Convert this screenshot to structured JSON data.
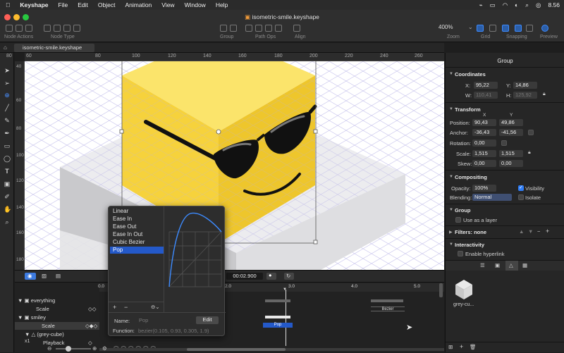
{
  "menubar": {
    "app": "Keyshape",
    "items": [
      "File",
      "Edit",
      "Object",
      "Animation",
      "View",
      "Window",
      "Help"
    ],
    "clock": "8.56"
  },
  "window": {
    "title": "isometric-smile.keyshape"
  },
  "toolbar": {
    "groups": [
      "Node Actions",
      "Node Type",
      "Group",
      "Path Ops",
      "Align",
      "Zoom",
      "Grid",
      "Snapping",
      "Preview"
    ],
    "zoom_value": "400%"
  },
  "tabs": {
    "document": "isometric-smile.keyshape"
  },
  "ruler": {
    "h_ticks": [
      "80",
      "60",
      "80",
      "100",
      "120",
      "140",
      "160",
      "180",
      "200",
      "220",
      "240",
      "260"
    ],
    "v_ticks": [
      "40",
      "60",
      "80",
      "100",
      "120",
      "140",
      "160",
      "180"
    ]
  },
  "inspector": {
    "title": "Group",
    "coordinates": {
      "label": "Coordinates",
      "x_label": "X:",
      "x": "95,22",
      "y_label": "Y:",
      "y": "14,86",
      "w_label": "W:",
      "w": "110,41",
      "h_label": "H:",
      "h": "125,92"
    },
    "transform": {
      "label": "Transform",
      "col_x": "X",
      "col_y": "Y",
      "position_label": "Position:",
      "position_x": "90,43",
      "position_y": "49,86",
      "anchor_label": "Anchor:",
      "anchor_x": "-36,43",
      "anchor_y": "-41,56",
      "rotation_label": "Rotation:",
      "rotation": "0,00",
      "scale_label": "Scale:",
      "scale_x": "1,515",
      "scale_y": "1,515",
      "skew_label": "Skew:",
      "skew_x": "0,00",
      "skew_y": "0,00"
    },
    "compositing": {
      "label": "Compositing",
      "opacity_label": "Opacity:",
      "opacity": "100%",
      "visibility": "Visibility",
      "blending_label": "Blending:",
      "blending": "Normal",
      "isolate": "Isolate"
    },
    "group": {
      "label": "Group",
      "use_as_layer": "Use as a layer"
    },
    "filters": {
      "label": "Filters: none"
    },
    "interactivity": {
      "label": "Interactivity",
      "enable_hyperlink": "Enable hyperlink"
    },
    "asset": {
      "name": "grey-cu..."
    }
  },
  "timeline": {
    "time": "00:02.900",
    "ruler": [
      "0.0",
      "2.0",
      "3.0",
      "4.0",
      "5.0"
    ],
    "rows": [
      {
        "name": "everything",
        "level": 0
      },
      {
        "name": "Scale",
        "level": 1
      },
      {
        "name": "smiley",
        "level": 0
      },
      {
        "name": "Scale",
        "level": 1
      },
      {
        "name": "(grey-cube)",
        "level": 0
      },
      {
        "name": "Playback",
        "level": 1
      }
    ],
    "bezier_label": "Bezier",
    "pop_label": "Pop",
    "speed": "x1"
  },
  "easing_popup": {
    "items": [
      "Linear",
      "Ease In",
      "Ease Out",
      "Ease In Out",
      "Cubic Bezier",
      "Pop"
    ],
    "selected": "Pop",
    "name_label": "Name:",
    "name_placeholder": "Pop",
    "edit_label": "Edit",
    "function_label": "Function:",
    "function_value": "bezier(0.105, 0.93, 0.305, 1.9)"
  },
  "colors": {
    "accent": "#2f7df6",
    "cube_top": "#fbe46b",
    "cube_left": "#f6d23c",
    "cube_right": "#eec62c"
  }
}
